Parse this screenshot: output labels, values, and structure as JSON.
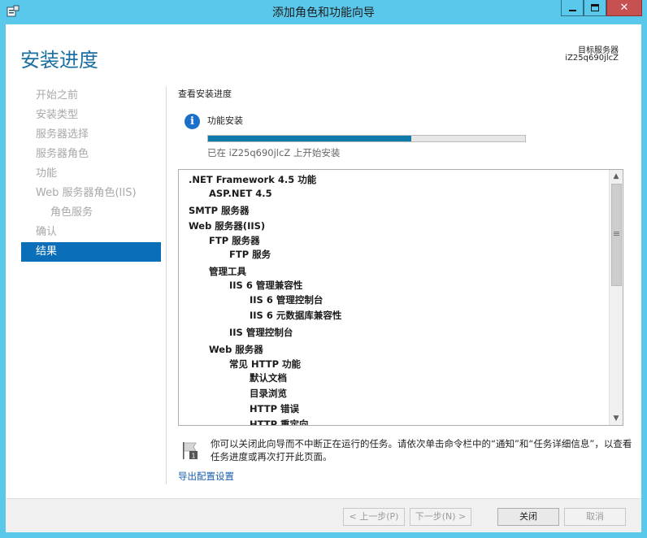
{
  "window": {
    "title": "添加角色和功能向导",
    "close_glyph": "✕"
  },
  "header": {
    "page_title": "安装进度",
    "target_label": "目标服务器",
    "target_name": "iZ25q690jlcZ"
  },
  "nav": {
    "items": [
      {
        "label": "开始之前"
      },
      {
        "label": "安装类型"
      },
      {
        "label": "服务器选择"
      },
      {
        "label": "服务器角色"
      },
      {
        "label": "功能"
      },
      {
        "label": "Web 服务器角色(IIS)"
      },
      {
        "label": "角色服务"
      },
      {
        "label": "确认"
      },
      {
        "label": "结果"
      }
    ],
    "active_index": 8
  },
  "main": {
    "section_heading": "查看安装进度",
    "info_glyph": "i",
    "feature_label": "功能安装",
    "progress_fraction": 0.64,
    "status_text": "已在 iZ25q690jlcZ 上开始安装",
    "tree": [
      {
        "label": ".NET Framework 4.5 功能",
        "level": 0
      },
      {
        "label": "ASP.NET 4.5",
        "level": 1
      },
      {
        "label": "SMTP 服务器",
        "level": 0
      },
      {
        "label": "Web 服务器(IIS)",
        "level": 0
      },
      {
        "label": "FTP 服务器",
        "level": 1
      },
      {
        "label": "FTP 服务",
        "level": 2
      },
      {
        "label": "管理工具",
        "level": 1
      },
      {
        "label": "IIS 6 管理兼容性",
        "level": 2
      },
      {
        "label": "IIS 6 管理控制台",
        "level": 3
      },
      {
        "label": "IIS 6 元数据库兼容性",
        "level": 3
      },
      {
        "label": "IIS 管理控制台",
        "level": 2
      },
      {
        "label": "Web 服务器",
        "level": 1
      },
      {
        "label": "常见 HTTP 功能",
        "level": 2
      },
      {
        "label": "默认文档",
        "level": 3
      },
      {
        "label": "目录浏览",
        "level": 3
      },
      {
        "label": "HTTP 错误",
        "level": 3
      },
      {
        "label": "HTTP 重定向",
        "level": 3
      }
    ],
    "scroll_up_glyph": "▲",
    "scroll_down_glyph": "▼",
    "notice": "你可以关闭此向导而不中断正在运行的任务。请依次单击命令栏中的“通知”和“任务详细信息”，以查看任务进度或再次打开此页面。",
    "export_link": "导出配置设置"
  },
  "footer": {
    "prev_label": "< 上一步(P)",
    "next_label": "下一步(N) >",
    "close_label": "关闭",
    "cancel_label": "取消"
  },
  "colors": {
    "title_bar": "#5ac8ea",
    "accent": "#0a6fb8",
    "progress_fill": "#0e7aaa",
    "page_title": "#1a6fa3"
  }
}
